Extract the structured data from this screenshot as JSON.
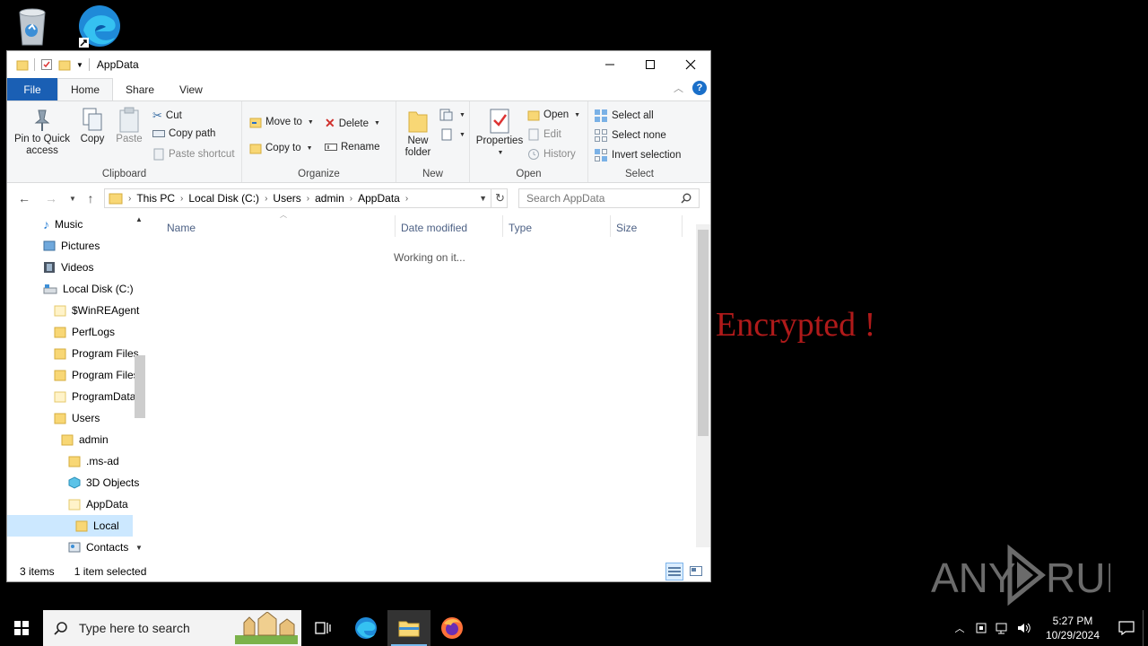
{
  "desktop": {
    "encrypted_text": "Encrypted !",
    "watermark": "ANY RUN"
  },
  "window": {
    "title": "AppData",
    "controls": {
      "minimize": "minimize",
      "maximize": "maximize",
      "close": "close"
    }
  },
  "tabs": {
    "file": "File",
    "home": "Home",
    "share": "Share",
    "view": "View"
  },
  "ribbon": {
    "clipboard": {
      "label": "Clipboard",
      "pin": "Pin to Quick access",
      "pin_line1": "Pin to Quick",
      "pin_line2": "access",
      "copy": "Copy",
      "paste": "Paste",
      "cut": "Cut",
      "copy_path": "Copy path",
      "paste_shortcut": "Paste shortcut"
    },
    "organize": {
      "label": "Organize",
      "move_to": "Move to",
      "copy_to": "Copy to",
      "delete": "Delete",
      "rename": "Rename"
    },
    "new": {
      "label": "New",
      "new_folder_line1": "New",
      "new_folder_line2": "folder"
    },
    "open": {
      "label": "Open",
      "properties": "Properties",
      "open": "Open",
      "edit": "Edit",
      "history": "History"
    },
    "select": {
      "label": "Select",
      "select_all": "Select all",
      "select_none": "Select none",
      "invert": "Invert selection"
    }
  },
  "address": {
    "crumbs": [
      "This PC",
      "Local Disk (C:)",
      "Users",
      "admin",
      "AppData"
    ],
    "search_placeholder": "Search AppData"
  },
  "nav": {
    "items": [
      {
        "label": "Music",
        "icon": "music-icon"
      },
      {
        "label": "Pictures",
        "icon": "pictures-icon"
      },
      {
        "label": "Videos",
        "icon": "videos-icon"
      },
      {
        "label": "Local Disk (C:)",
        "icon": "drive-icon"
      },
      {
        "label": "$WinREAgent",
        "icon": "folder-icon"
      },
      {
        "label": "PerfLogs",
        "icon": "folder-icon"
      },
      {
        "label": "Program Files",
        "icon": "folder-icon"
      },
      {
        "label": "Program Files",
        "icon": "folder-icon"
      },
      {
        "label": "ProgramData",
        "icon": "folder-icon"
      },
      {
        "label": "Users",
        "icon": "folder-icon"
      },
      {
        "label": "admin",
        "icon": "folder-icon"
      },
      {
        "label": ".ms-ad",
        "icon": "folder-icon"
      },
      {
        "label": "3D Objects",
        "icon": "3d-objects-icon"
      },
      {
        "label": "AppData",
        "icon": "folder-icon"
      },
      {
        "label": "Local",
        "icon": "folder-icon"
      },
      {
        "label": "Contacts",
        "icon": "contacts-icon"
      }
    ]
  },
  "columns": {
    "name": "Name",
    "date": "Date modified",
    "type": "Type",
    "size": "Size"
  },
  "main": {
    "working": "Working on it..."
  },
  "status": {
    "items": "3 items",
    "selected": "1 item selected"
  },
  "taskbar": {
    "search_placeholder": "Type here to search",
    "time": "5:27 PM",
    "date": "10/29/2024"
  },
  "colors": {
    "accent": "#1a5fb4",
    "selection": "#cce8ff",
    "encrypted": "#b01a1a"
  }
}
